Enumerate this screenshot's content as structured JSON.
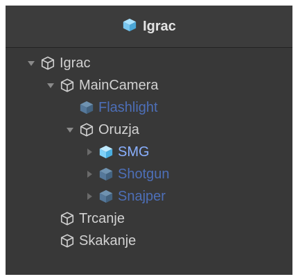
{
  "header": {
    "title": "Igrac",
    "icon": "prefab-cube-icon"
  },
  "colors": {
    "panel_bg": "#383838",
    "header_bg": "#3c3c3c",
    "text": "#d2d2d2",
    "prefab_text": "#4d6fb8",
    "prefab_text_selected": "#8ab0ff",
    "prefab_icon": "#78c6ef"
  },
  "tree": [
    {
      "label": "Igrac",
      "depth": 0,
      "expanded": true,
      "arrow": "expanded",
      "kind": "object"
    },
    {
      "label": "MainCamera",
      "depth": 1,
      "expanded": true,
      "arrow": "expanded",
      "kind": "object"
    },
    {
      "label": "Flashlight",
      "depth": 2,
      "arrow": "none",
      "kind": "prefab"
    },
    {
      "label": "Oruzja",
      "depth": 2,
      "arrow": "expanded",
      "kind": "object"
    },
    {
      "label": "SMG",
      "depth": 3,
      "arrow": "collapsed",
      "kind": "prefab-selected"
    },
    {
      "label": "Shotgun",
      "depth": 3,
      "arrow": "collapsed",
      "kind": "prefab"
    },
    {
      "label": "Snajper",
      "depth": 3,
      "arrow": "collapsed",
      "kind": "prefab"
    },
    {
      "label": "Trcanje",
      "depth": 1,
      "arrow": "none",
      "kind": "object"
    },
    {
      "label": "Skakanje",
      "depth": 1,
      "arrow": "none",
      "kind": "object"
    }
  ]
}
